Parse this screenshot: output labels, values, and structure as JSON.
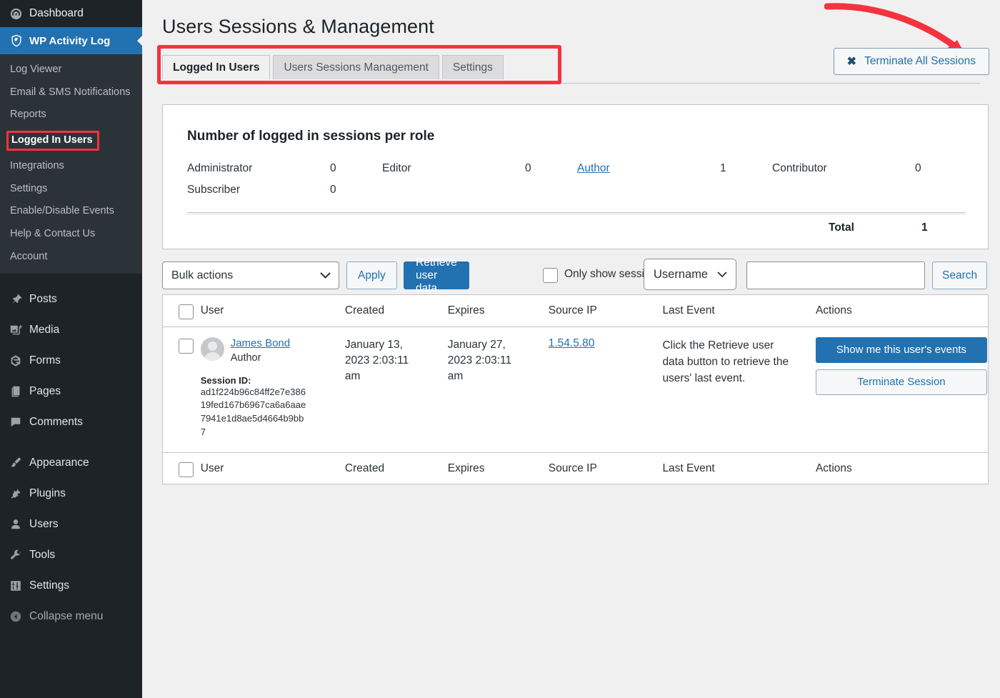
{
  "sidebar": {
    "top_items": [
      {
        "label": "Dashboard",
        "icon": "dashboard-icon"
      }
    ],
    "active_item": {
      "label": "WP Activity Log",
      "icon": "shield-icon"
    },
    "submenu": [
      {
        "label": "Log Viewer",
        "selected": false
      },
      {
        "label": "Email & SMS Notifications",
        "selected": false
      },
      {
        "label": "Reports",
        "selected": false
      },
      {
        "label": "Logged In Users",
        "selected": true
      },
      {
        "label": "Integrations",
        "selected": false
      },
      {
        "label": "Settings",
        "selected": false
      },
      {
        "label": "Enable/Disable Events",
        "selected": false
      },
      {
        "label": "Help & Contact Us",
        "selected": false
      },
      {
        "label": "Account",
        "selected": false
      }
    ],
    "items": [
      {
        "label": "Posts",
        "icon": "pin-icon"
      },
      {
        "label": "Media",
        "icon": "media-icon"
      },
      {
        "label": "Forms",
        "icon": "forms-icon"
      },
      {
        "label": "Pages",
        "icon": "pages-icon"
      },
      {
        "label": "Comments",
        "icon": "comment-icon"
      }
    ],
    "items2": [
      {
        "label": "Appearance",
        "icon": "brush-icon"
      },
      {
        "label": "Plugins",
        "icon": "plug-icon"
      },
      {
        "label": "Users",
        "icon": "user-icon"
      },
      {
        "label": "Tools",
        "icon": "wrench-icon"
      },
      {
        "label": "Settings",
        "icon": "sliders-icon"
      }
    ],
    "collapse": {
      "label": "Collapse menu",
      "icon": "collapse-icon"
    }
  },
  "header": {
    "title": "Users Sessions & Management",
    "terminate_all_label": "Terminate All Sessions",
    "terminate_all_icon": "close-x-icon"
  },
  "tabs": [
    {
      "label": "Logged In Users",
      "active": true
    },
    {
      "label": "Users Sessions Management",
      "active": false
    },
    {
      "label": "Settings",
      "active": false
    }
  ],
  "roles_panel": {
    "title": "Number of logged in sessions per role",
    "rows": [
      [
        {
          "name": "Administrator",
          "value": "0",
          "link": false
        },
        {
          "name": "Editor",
          "value": "0",
          "link": false
        },
        {
          "name": "Author",
          "value": "1",
          "link": true
        },
        {
          "name": "Contributor",
          "value": "0",
          "link": false
        }
      ],
      [
        {
          "name": "Subscriber",
          "value": "0",
          "link": false
        }
      ]
    ],
    "total_label": "Total",
    "total_value": "1"
  },
  "toolbar": {
    "bulk_actions_value": "Bulk actions",
    "apply_label": "Apply",
    "retrieve_label": "Retrieve user data",
    "only_show_label": "Only show sessions with",
    "user_select_value": "Username",
    "search_value": "",
    "search_placeholder": "",
    "search_label": "Search"
  },
  "table": {
    "columns": [
      "User",
      "Created",
      "Expires",
      "Source IP",
      "Last Event",
      "Actions"
    ],
    "rows": [
      {
        "user_name": "James Bond",
        "user_role": "Author",
        "session_id_label": "Session ID:",
        "session_id": "ad1f224b96c84ff2e7e38619fed167b6967ca6a6aae7941e1d8ae5d4664b9bb7",
        "created": "January 13, 2023 2:03:11 am",
        "expires": "January 27, 2023 2:03:11 am",
        "source_ip": "1.54.5.80",
        "last_event": "Click the Retrieve user data button to retrieve the users' last event.",
        "action_primary": "Show me this user's events",
        "action_secondary": "Terminate Session"
      }
    ]
  },
  "colors": {
    "sidebar_bg": "#1d2327",
    "submenu_bg": "#2c3338",
    "accent_blue": "#2271b1",
    "annotation_red": "#f5333f",
    "page_bg": "#f0f0f1"
  }
}
